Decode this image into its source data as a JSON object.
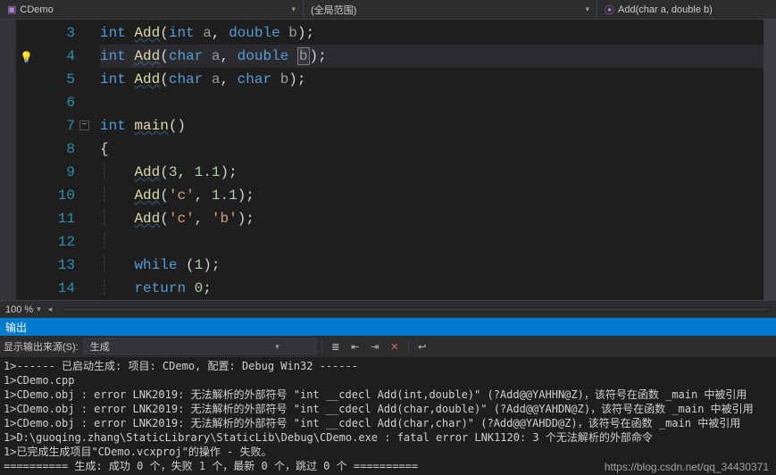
{
  "topbar": {
    "project": "CDemo",
    "scope": "(全局范围)",
    "function": "Add(char a, double b)"
  },
  "code": {
    "lines": [
      {
        "n": 3,
        "indent": "",
        "tokens": [
          [
            "kw",
            "int"
          ],
          [
            "pn",
            " "
          ],
          [
            "fn",
            "Add"
          ],
          [
            "pn",
            "("
          ],
          [
            "kw",
            "int"
          ],
          [
            "pn",
            " "
          ],
          [
            "param",
            "a"
          ],
          [
            "pn",
            ", "
          ],
          [
            "kw",
            "double"
          ],
          [
            "pn",
            " "
          ],
          [
            "param",
            "b"
          ],
          [
            "pn",
            ");"
          ]
        ]
      },
      {
        "n": 4,
        "indent": "",
        "hl": true,
        "tokens": [
          [
            "kw",
            "int"
          ],
          [
            "pn",
            " "
          ],
          [
            "fn",
            "Add"
          ],
          [
            "pn",
            "("
          ],
          [
            "kw",
            "char"
          ],
          [
            "pn",
            " "
          ],
          [
            "param",
            "a"
          ],
          [
            "pn",
            ", "
          ],
          [
            "kw",
            "double"
          ],
          [
            "pn",
            " "
          ],
          [
            "sel",
            "b"
          ],
          [
            "pn",
            ");"
          ]
        ]
      },
      {
        "n": 5,
        "indent": "",
        "tokens": [
          [
            "kw",
            "int"
          ],
          [
            "pn",
            " "
          ],
          [
            "fn",
            "Add"
          ],
          [
            "pn",
            "("
          ],
          [
            "kw",
            "char"
          ],
          [
            "pn",
            " "
          ],
          [
            "param",
            "a"
          ],
          [
            "pn",
            ", "
          ],
          [
            "kw",
            "char"
          ],
          [
            "pn",
            " "
          ],
          [
            "param",
            "b"
          ],
          [
            "pn",
            ");"
          ]
        ]
      },
      {
        "n": 6,
        "indent": "",
        "tokens": []
      },
      {
        "n": 7,
        "indent": "",
        "fold": true,
        "tokens": [
          [
            "kw",
            "int"
          ],
          [
            "pn",
            " "
          ],
          [
            "fn",
            "main"
          ],
          [
            "pn",
            "()"
          ]
        ]
      },
      {
        "n": 8,
        "indent": "",
        "tokens": [
          [
            "pn",
            "{"
          ]
        ]
      },
      {
        "n": 9,
        "indent": "    ",
        "tokens": [
          [
            "fn",
            "Add"
          ],
          [
            "pn",
            "("
          ],
          [
            "num",
            "3"
          ],
          [
            "pn",
            ", "
          ],
          [
            "num",
            "1.1"
          ],
          [
            "pn",
            ");"
          ]
        ]
      },
      {
        "n": 10,
        "indent": "    ",
        "tokens": [
          [
            "fn",
            "Add"
          ],
          [
            "pn",
            "("
          ],
          [
            "str",
            "'c'"
          ],
          [
            "pn",
            ", "
          ],
          [
            "num",
            "1.1"
          ],
          [
            "pn",
            ");"
          ]
        ]
      },
      {
        "n": 11,
        "indent": "    ",
        "tokens": [
          [
            "fn",
            "Add"
          ],
          [
            "pn",
            "("
          ],
          [
            "str",
            "'c'"
          ],
          [
            "pn",
            ", "
          ],
          [
            "str",
            "'b'"
          ],
          [
            "pn",
            ");"
          ]
        ]
      },
      {
        "n": 12,
        "indent": "    ",
        "tokens": []
      },
      {
        "n": 13,
        "indent": "    ",
        "tokens": [
          [
            "kw",
            "while"
          ],
          [
            "pn",
            " ("
          ],
          [
            "num",
            "1"
          ],
          [
            "pn",
            ");"
          ]
        ]
      },
      {
        "n": 14,
        "indent": "    ",
        "tokens": [
          [
            "kw",
            "return"
          ],
          [
            "pn",
            " "
          ],
          [
            "num",
            "0"
          ],
          [
            "pn",
            ";"
          ]
        ]
      }
    ]
  },
  "zoom": "100 %",
  "output": {
    "title": "输出",
    "source_label": "显示输出来源(S):",
    "source_value": "生成",
    "lines": [
      "1>------ 已启动生成: 项目: CDemo, 配置: Debug Win32 ------",
      "1>CDemo.cpp",
      "1>CDemo.obj : error LNK2019: 无法解析的外部符号 \"int __cdecl Add(int,double)\" (?Add@@YAHHN@Z)，该符号在函数 _main 中被引用",
      "1>CDemo.obj : error LNK2019: 无法解析的外部符号 \"int __cdecl Add(char,double)\" (?Add@@YAHDN@Z)，该符号在函数 _main 中被引用",
      "1>CDemo.obj : error LNK2019: 无法解析的外部符号 \"int __cdecl Add(char,char)\" (?Add@@YAHDD@Z)，该符号在函数 _main 中被引用",
      "1>D:\\guoqing.zhang\\StaticLibrary\\StaticLib\\Debug\\CDemo.exe : fatal error LNK1120: 3 个无法解析的外部命令",
      "1>已完成生成项目\"CDemo.vcxproj\"的操作 - 失败。",
      "========== 生成: 成功 0 个，失败 1 个，最新 0 个，跳过 0 个 =========="
    ]
  },
  "watermark": "https://blog.csdn.net/qq_34430371"
}
